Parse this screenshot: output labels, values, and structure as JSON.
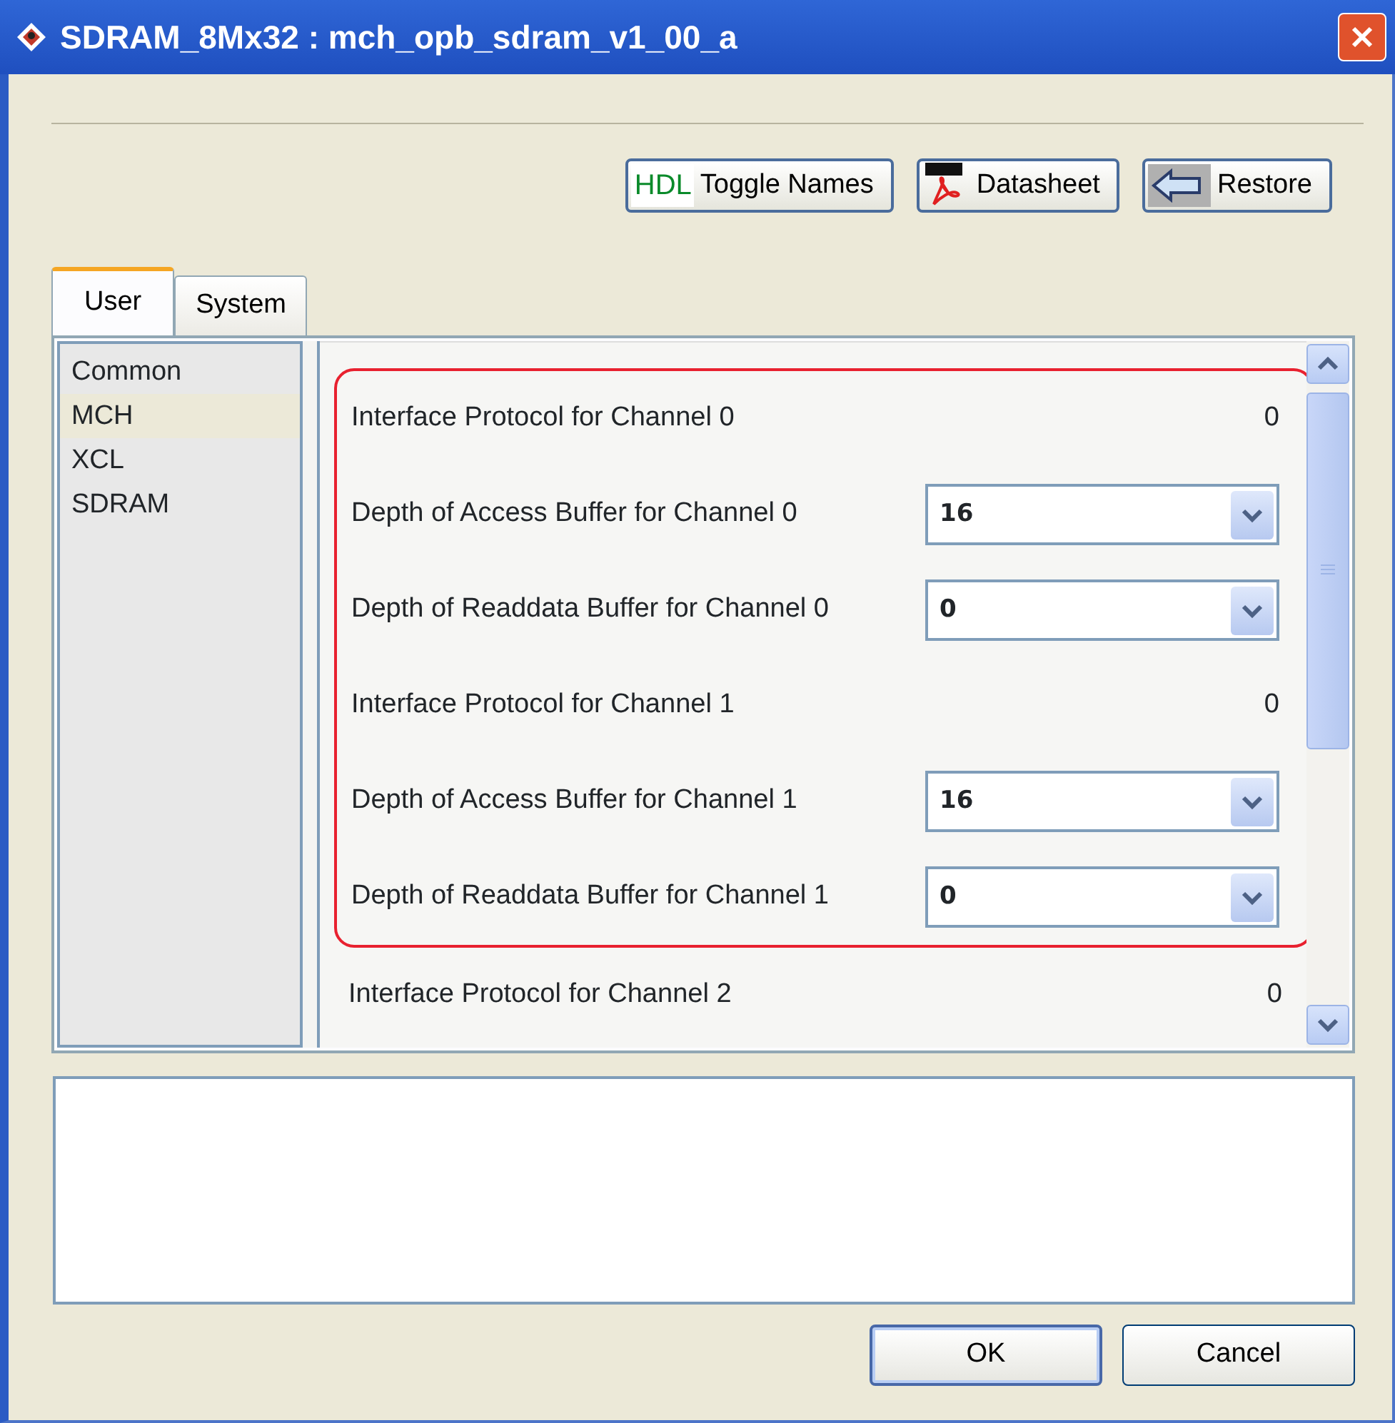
{
  "window": {
    "title": "SDRAM_8Mx32 : mch_opb_sdram_v1_00_a"
  },
  "toolbar": [
    {
      "kind": "hdl",
      "icon_text": "HDL",
      "label": "Toggle Names"
    },
    {
      "kind": "pdf",
      "label": "Datasheet"
    },
    {
      "kind": "restore",
      "label": "Restore"
    }
  ],
  "tabs": [
    {
      "label": "User",
      "selected": true
    },
    {
      "label": "System",
      "selected": false
    }
  ],
  "sidebar": {
    "items": [
      {
        "label": "Common",
        "selected": false
      },
      {
        "label": "MCH",
        "selected": true
      },
      {
        "label": "XCL",
        "selected": false
      },
      {
        "label": "SDRAM",
        "selected": false
      }
    ]
  },
  "parameter_groups": [
    {
      "highlighted": true,
      "rows": [
        {
          "kind": "readonly",
          "label": "Interface Protocol for Channel 0",
          "value": "0"
        },
        {
          "kind": "dropdown",
          "label": "Depth of Access Buffer for Channel 0",
          "value": "16"
        },
        {
          "kind": "dropdown",
          "label": "Depth of Readdata Buffer for Channel 0",
          "value": "0"
        },
        {
          "kind": "readonly",
          "label": "Interface Protocol for Channel 1",
          "value": "0"
        },
        {
          "kind": "dropdown",
          "label": "Depth of Access Buffer for Channel 1",
          "value": "16"
        },
        {
          "kind": "dropdown",
          "label": "Depth of Readdata Buffer for Channel 1",
          "value": "0"
        }
      ]
    },
    {
      "highlighted": false,
      "rows": [
        {
          "kind": "readonly",
          "label": "Interface Protocol for Channel 2",
          "value": "0"
        }
      ]
    }
  ],
  "buttons": [
    {
      "label": "OK",
      "default": true
    },
    {
      "label": "Cancel",
      "default": false
    }
  ]
}
